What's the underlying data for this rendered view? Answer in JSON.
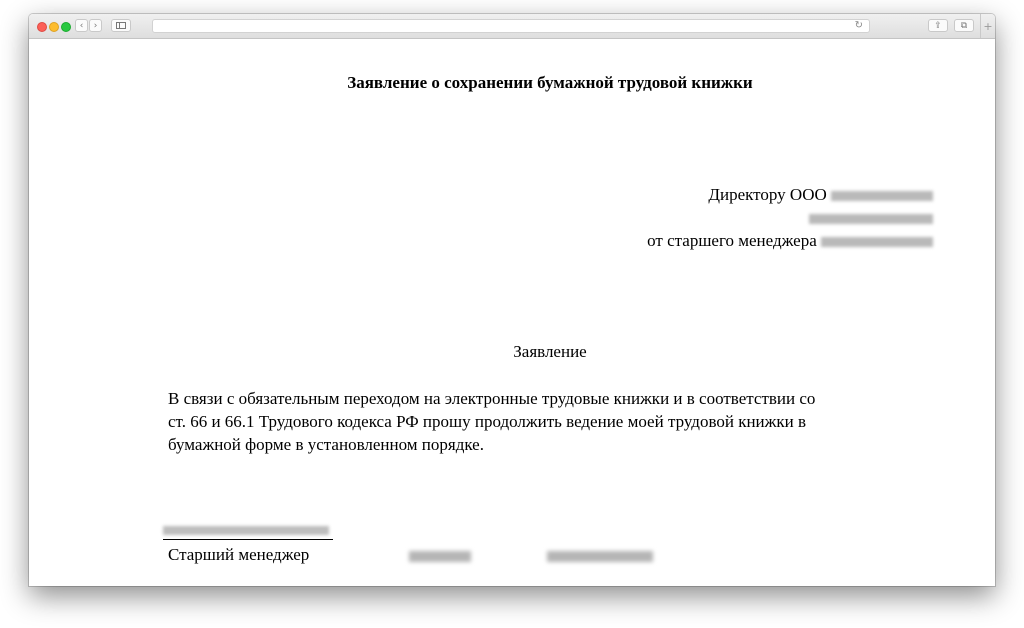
{
  "browser": {
    "nav_back": "‹",
    "nav_forward": "›",
    "sidebar_icon": "sidebar-icon",
    "reload_icon": "↻",
    "share_icon": "⇪",
    "tabs_icon": "⧉",
    "new_tab": "+"
  },
  "document": {
    "title": "Заявление о сохранении бумажной трудовой книжки",
    "addressee": {
      "line1": "Директору ООО",
      "line3": "от старшего менеджера"
    },
    "heading": "Заявление",
    "body": {
      "line1": "В связи с обязательным переходом на электронные трудовые книжки и в соответствии со",
      "line2": "ст. 66 и 66.1 Трудового кодекса РФ прошу продолжить ведение моей трудовой книжки в",
      "line3": "бумажной форме в установленном порядке."
    },
    "signature": {
      "position": "Старший менеджер"
    }
  }
}
